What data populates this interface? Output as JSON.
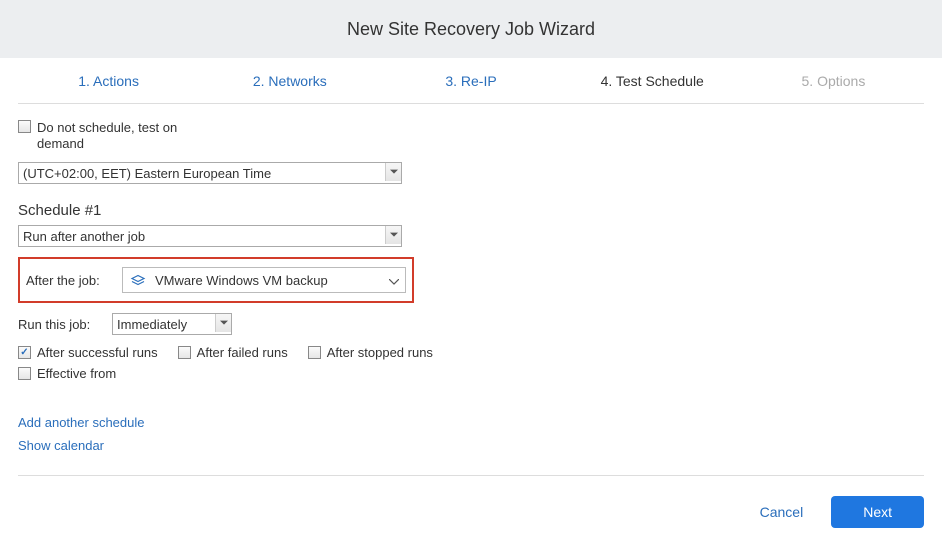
{
  "header": {
    "title": "New Site Recovery Job Wizard"
  },
  "steps": [
    {
      "label": "1. Actions",
      "state": "link"
    },
    {
      "label": "2. Networks",
      "state": "link"
    },
    {
      "label": "3. Re-IP",
      "state": "link"
    },
    {
      "label": "4. Test Schedule",
      "state": "active"
    },
    {
      "label": "5. Options",
      "state": "disabled"
    }
  ],
  "noSchedule": {
    "label": "Do not schedule, test on demand",
    "checked": false
  },
  "timezone": {
    "value": "(UTC+02:00, EET) Eastern European Time"
  },
  "scheduleTitle": "Schedule #1",
  "scheduleMode": {
    "value": "Run after another job"
  },
  "afterJob": {
    "label": "After the job:",
    "value": "VMware Windows VM backup"
  },
  "runThis": {
    "label": "Run this job:",
    "value": "Immediately"
  },
  "conditions": {
    "afterSuccessful": {
      "label": "After successful runs",
      "checked": true
    },
    "afterFailed": {
      "label": "After failed runs",
      "checked": false
    },
    "afterStopped": {
      "label": "After stopped runs",
      "checked": false
    },
    "effectiveFrom": {
      "label": "Effective from",
      "checked": false
    }
  },
  "links": {
    "addSchedule": "Add another schedule",
    "showCalendar": "Show calendar"
  },
  "footer": {
    "cancel": "Cancel",
    "next": "Next"
  }
}
